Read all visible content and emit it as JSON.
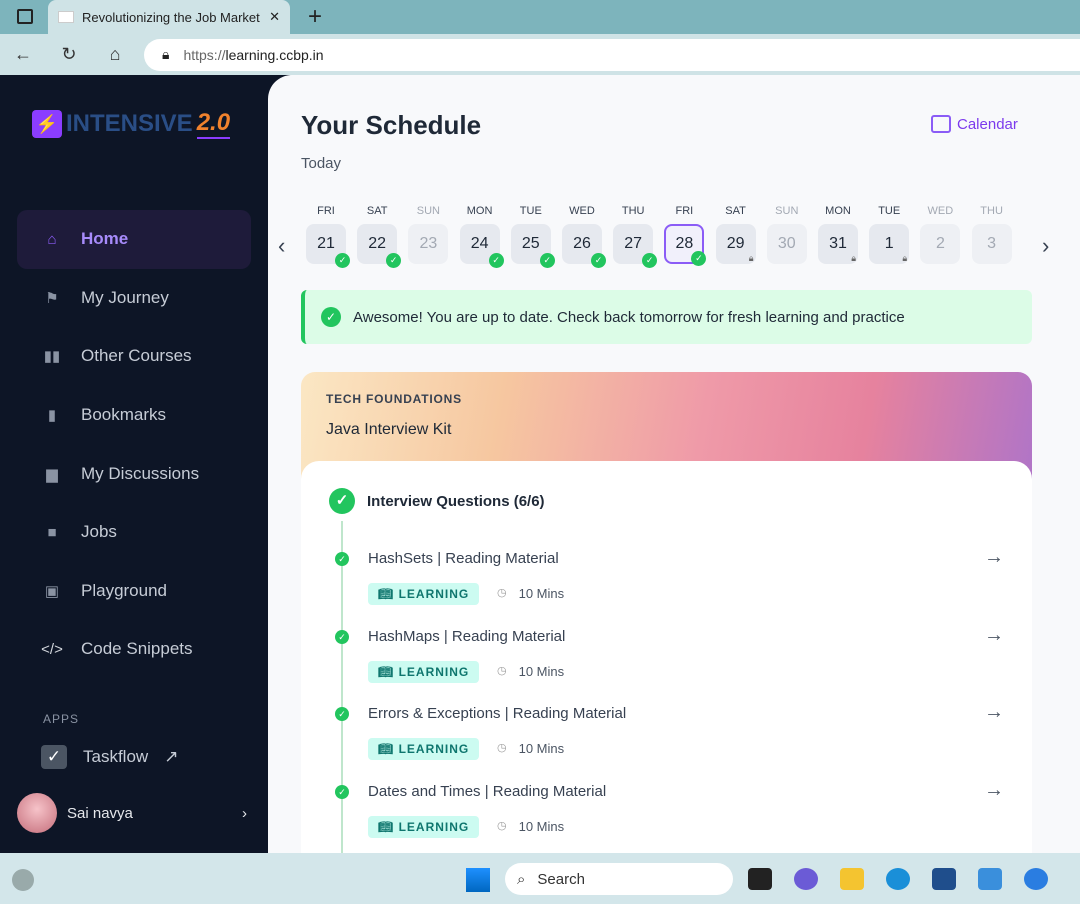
{
  "browser": {
    "tab_title": "Revolutionizing the Job Market |",
    "url_proto": "https://",
    "url_host": "learning.ccbp.in"
  },
  "sidebar": {
    "logo_text": "INTENSIVE",
    "logo_version": "2.0",
    "items": [
      {
        "label": "Home",
        "icon": "home-icon"
      },
      {
        "label": "My Journey",
        "icon": "flag-icon"
      },
      {
        "label": "Other Courses",
        "icon": "book-icon"
      },
      {
        "label": "Bookmarks",
        "icon": "bookmark-icon"
      },
      {
        "label": "My Discussions",
        "icon": "discussion-icon"
      },
      {
        "label": "Jobs",
        "icon": "briefcase-icon"
      },
      {
        "label": "Playground",
        "icon": "terminal-icon"
      },
      {
        "label": "Code Snippets",
        "icon": "code-icon"
      }
    ],
    "apps_label": "APPS",
    "taskflow": "Taskflow",
    "user": "Sai navya"
  },
  "main": {
    "title": "Your Schedule",
    "calendar": "Calendar",
    "today": "Today",
    "days": [
      {
        "d": "FRI",
        "n": "21",
        "s": "done"
      },
      {
        "d": "SAT",
        "n": "22",
        "s": "done"
      },
      {
        "d": "SUN",
        "n": "23",
        "s": "off"
      },
      {
        "d": "MON",
        "n": "24",
        "s": "done"
      },
      {
        "d": "TUE",
        "n": "25",
        "s": "done"
      },
      {
        "d": "WED",
        "n": "26",
        "s": "done"
      },
      {
        "d": "THU",
        "n": "27",
        "s": "done"
      },
      {
        "d": "FRI",
        "n": "28",
        "s": "current"
      },
      {
        "d": "SAT",
        "n": "29",
        "s": "locked"
      },
      {
        "d": "SUN",
        "n": "30",
        "s": "off"
      },
      {
        "d": "MON",
        "n": "31",
        "s": "locked"
      },
      {
        "d": "TUE",
        "n": "1",
        "s": "locked"
      },
      {
        "d": "WED",
        "n": "2",
        "s": "off"
      },
      {
        "d": "THU",
        "n": "3",
        "s": "off"
      }
    ],
    "banner": "Awesome! You are up to date. Check back tomorrow for fresh learning and practice",
    "card": {
      "category": "TECH FOUNDATIONS",
      "title": "Java Interview Kit",
      "section": "Interview Questions (6/6)",
      "items": [
        {
          "title": "HashSets | Reading Material",
          "badge": "LEARNING",
          "duration": "10 Mins"
        },
        {
          "title": "HashMaps | Reading Material",
          "badge": "LEARNING",
          "duration": "10 Mins"
        },
        {
          "title": "Errors & Exceptions | Reading Material",
          "badge": "LEARNING",
          "duration": "10 Mins"
        },
        {
          "title": "Dates and Times | Reading Material",
          "badge": "LEARNING",
          "duration": "10 Mins"
        }
      ]
    }
  },
  "taskbar": {
    "search": "Search"
  }
}
